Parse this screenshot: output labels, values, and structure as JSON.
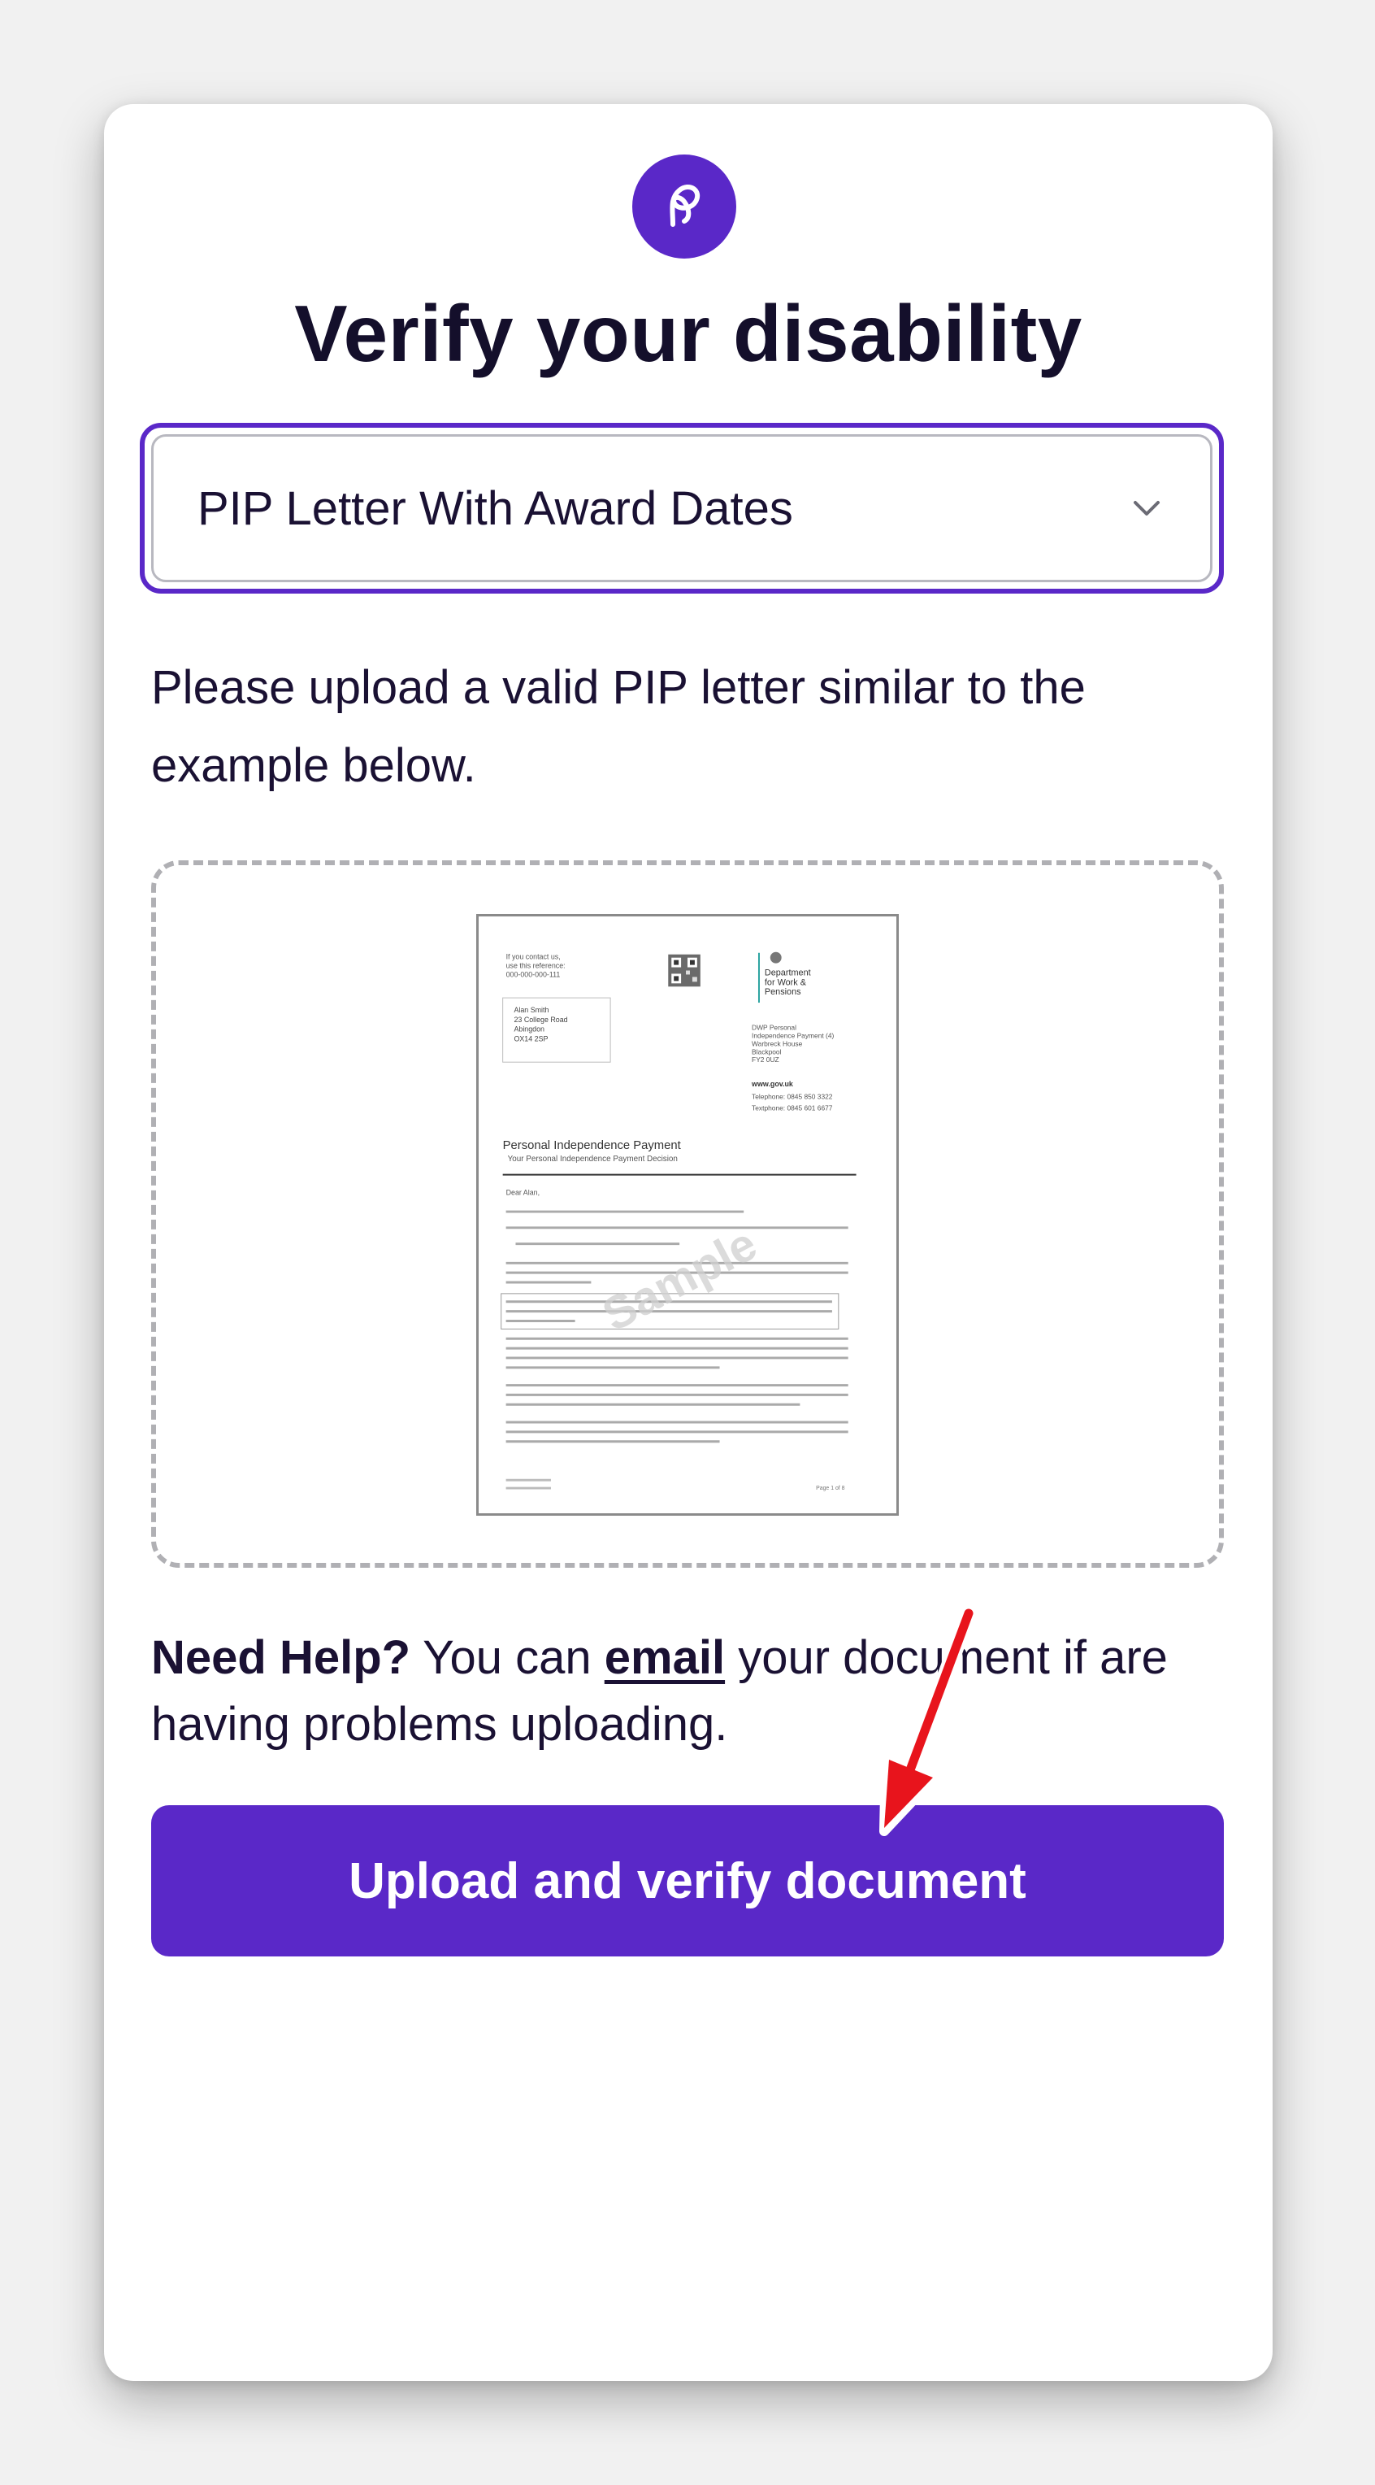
{
  "header": {
    "logo_icon": "p-logo-icon",
    "title": "Verify your disability"
  },
  "document_select": {
    "selected_value": "PIP Letter With Award Dates",
    "icon": "chevron-down-icon"
  },
  "instructions": "Please upload a valid PIP letter similar to the example below.",
  "sample_document": {
    "watermark": "Sample",
    "contact_lines": [
      "If you contact us,",
      "use this reference:",
      "000-000-000-111"
    ],
    "address_lines": [
      "Alan Smith",
      "23 College Road",
      "Abingdon",
      "OX14 2SP"
    ],
    "department_lines": [
      "Department",
      "for Work &",
      "Pensions"
    ],
    "office_lines": [
      "DWP Personal",
      "Independence Payment (4)",
      "Warbreck House",
      "Blackpool",
      "FY2 0UZ"
    ],
    "website": "www.gov.uk",
    "telephone_1": "Telephone: 0845 850 3322",
    "telephone_2": "Textphone: 0845 601 6677",
    "heading": "Personal Independence Payment",
    "subheading": "Your Personal Independence Payment Decision",
    "greeting": "Dear Alan,",
    "page_label": "Page 1 of 8"
  },
  "help": {
    "lead": "Need Help?",
    "text_before": " You can ",
    "link_label": "email",
    "text_after": " your document if are having problems uploading."
  },
  "upload_button": {
    "label": "Upload and verify document"
  },
  "colors": {
    "accent": "#5a28c8",
    "annotation_arrow": "#e8141c",
    "text": "#1a1133"
  }
}
